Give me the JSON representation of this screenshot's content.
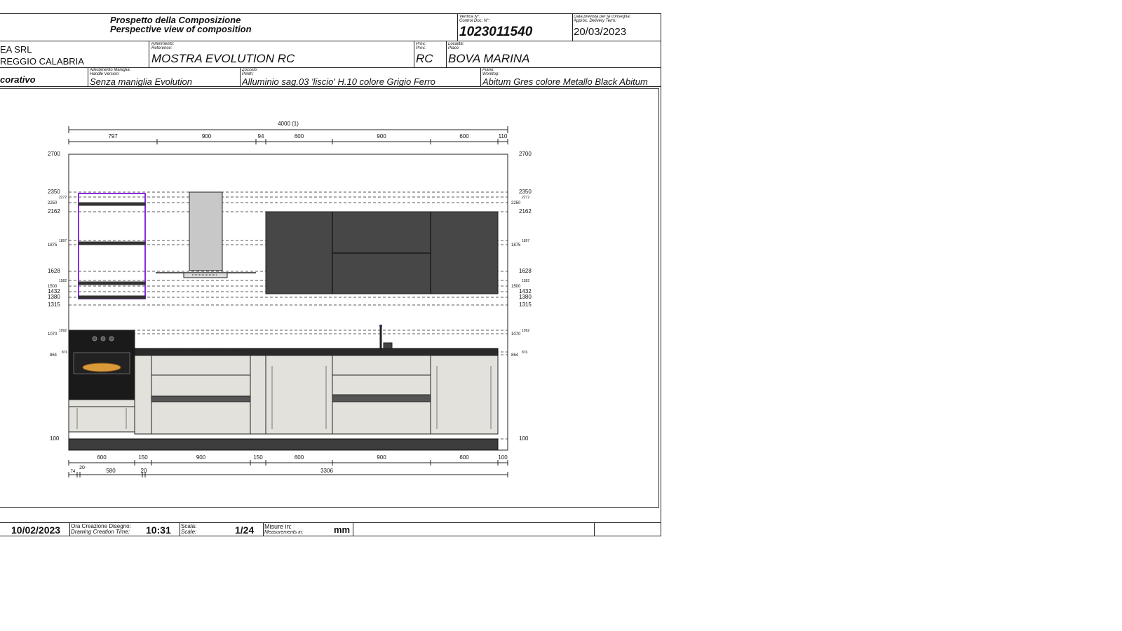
{
  "header": {
    "title_it": "Prospetto della Composizione",
    "title_en": "Perspective view of composition",
    "control_label_it": "Verifica N°:",
    "control_label_en": "Control Doc. N°:",
    "control_number": "1023011540",
    "delivery_label_it": "Data prevista per la consegna:",
    "delivery_label_en": "Approx. Delivery Term:",
    "delivery_date": "20/03/2023"
  },
  "row2": {
    "company": "EA SRL",
    "city": "REGGIO CALABRIA",
    "reference_label_it": "Riferimento:",
    "reference_label_en": "Reference:",
    "reference": "MOSTRA EVOLUTION RC",
    "prov_label_it": "Prov.:",
    "prov_label_en": "Prov.:",
    "prov": "RC",
    "place_label_it": "Località:",
    "place_label_en": "Place:",
    "place": "BOVA MARINA"
  },
  "row3": {
    "finish": "corativo",
    "handle_label_it": "Allestimento Maniglia:",
    "handle_label_en": "Handle Version:",
    "handle": "Senza maniglia Evolution",
    "plinth_label_it": "Zoccolo:",
    "plinth_label_en": "Plinth:",
    "plinth": "Alluminio sag.03 'liscio' H.10 colore Grigio Ferro",
    "worktop_label_it": "Piano:",
    "worktop_label_en": "Worktop:",
    "worktop": "Abitum Gres colore Metallo Black  Abitum"
  },
  "footer": {
    "date": "10/02/2023",
    "time_label_it": "Ora Creazione Disegno:",
    "time_label_en": "Drawing Creation Time:",
    "time": "10:31",
    "scale_label_it": "Scala:",
    "scale_label_en": "Scale:",
    "scale": "1/24",
    "measure_label_it": "Misure in:",
    "measure_label_en": "Measurements in:",
    "measure": "mm"
  },
  "drawing": {
    "overall_width": "4000 (1)",
    "top_dims": [
      "797",
      "900",
      "94",
      "600",
      "900",
      "600",
      "110"
    ],
    "bottom_dims": [
      "600",
      "150",
      "900",
      "150",
      "600",
      "900",
      "600",
      "100"
    ],
    "bottom_sub_dims": [
      "74",
      "20",
      "580",
      "20",
      "3306"
    ],
    "left_levels": [
      "2700",
      "2350",
      "2272",
      "2250",
      "2162",
      "1897",
      "1875",
      "1628",
      "1582",
      "1500",
      "1432",
      "1380",
      "1315",
      "1092",
      "1070",
      "876",
      "864",
      "100"
    ],
    "right_levels": [
      "2700",
      "2350",
      "2272",
      "2250",
      "2162",
      "1897",
      "1875",
      "1628",
      "1582",
      "1500",
      "1432",
      "1380",
      "1315",
      "1092",
      "1070",
      "876",
      "864",
      "100"
    ],
    "colors": {
      "line": "#222222",
      "base_door": "#e3e1dc",
      "wall_unit": "#474747",
      "plinth": "#3d3d3d",
      "worktop": "#2a2a2a",
      "shelf_frame": "#8a2be2",
      "hood": "#c8c8c8",
      "oven": "#1a1a1a"
    }
  }
}
